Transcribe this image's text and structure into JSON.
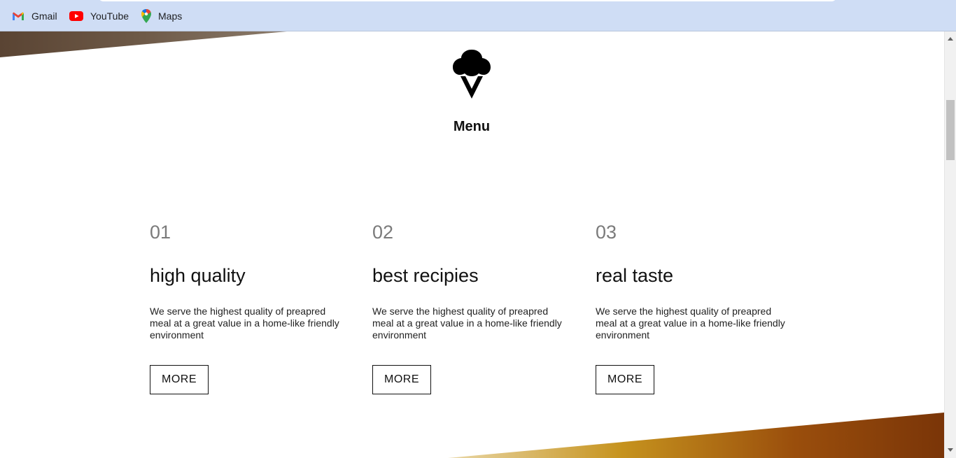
{
  "bookmarks": [
    {
      "label": "Gmail",
      "icon": "gmail-icon"
    },
    {
      "label": "YouTube",
      "icon": "youtube-icon"
    },
    {
      "label": "Maps",
      "icon": "maps-icon"
    }
  ],
  "header": {
    "logo_icon": "ice-cream-icon",
    "menu_label": "Menu"
  },
  "features": [
    {
      "number": "01",
      "title": "high quality",
      "description": "We serve the highest quality of preapred meal at a great value in a home-like friendly environment",
      "button_label": "MORE"
    },
    {
      "number": "02",
      "title": "best recipies",
      "description": "We serve the highest quality of preapred meal at a great value in a home-like friendly environment",
      "button_label": "MORE"
    },
    {
      "number": "03",
      "title": "real taste",
      "description": "We serve the highest quality of preapred meal at a great value in a home-like friendly environment",
      "button_label": "MORE"
    }
  ],
  "colors": {
    "bookmarks_bar": "#cfddf5",
    "number_text": "#7b7b7b",
    "accent_dark": "#111111"
  }
}
